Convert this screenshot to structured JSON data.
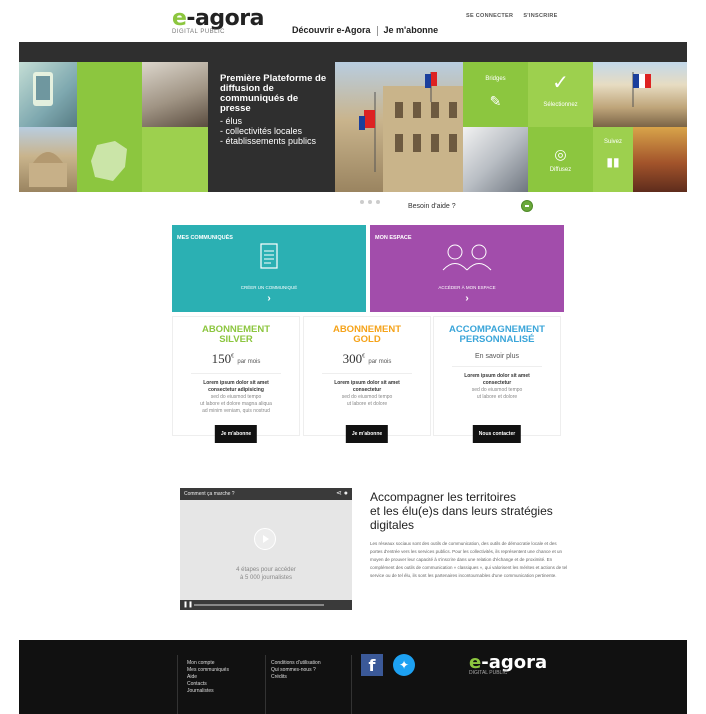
{
  "header": {
    "logo_mark_e": "e",
    "logo_mark_rest": "-agora",
    "logo_sub": "DIGITAL PUBLIC",
    "nav": [
      "Découvrir e-Agora",
      "Je m'abonne"
    ],
    "auth": {
      "login": "SE CONNECTER",
      "signup": "S'INSCRIRE"
    }
  },
  "hero": {
    "headline": "Première Plateforme de diffusion de communiqués de presse",
    "bullets": [
      "élus",
      "collectivités locales",
      "établissements publics"
    ],
    "tiles": {
      "bridges": "Bridges",
      "select": "Sélectionnez",
      "diffuse": "Diffusez",
      "follow": "Suivez"
    }
  },
  "slider": {
    "help": "Besoin d'aide ?"
  },
  "features": {
    "communiques": {
      "title": "MES COMMUNIQUÉS",
      "action": "CRÉER UN COMMUNIQUÉ",
      "color": "#2bb0b3"
    },
    "espace": {
      "title": "MON ESPACE",
      "action": "ACCÉDER À MON ESPACE",
      "color": "#a24dab"
    }
  },
  "pricing": [
    {
      "title1": "ABONNEMENT",
      "title2": "SILVER",
      "price": "150",
      "currency": "€",
      "per": "par mois",
      "desc_bold": [
        "Lorem ipsum dolor sit amet",
        "consectetur adipisicing"
      ],
      "desc": [
        "sed do eiusmod tempo",
        "ut labore et dolore magna aliqua",
        "ad minim veniam, quis nostrud"
      ],
      "button": "Je m'abonne",
      "color": "#8cc63f"
    },
    {
      "title1": "ABONNEMENT",
      "title2": "GOLD",
      "price": "300",
      "currency": "€",
      "per": "par mois",
      "desc_bold": [
        "Lorem ipsum dolor sit amet",
        "consectetur"
      ],
      "desc": [
        "sed do eiusmod tempo",
        "ut labore et dolore"
      ],
      "button": "Je m'abonne",
      "color": "#f5a31a"
    },
    {
      "title1": "ACCOMPAGNEMENT",
      "title2": "PERSONNALISÉ",
      "more": "En savoir plus",
      "desc_bold": [
        "Lorem ipsum dolor sit amet",
        "consectetur"
      ],
      "desc": [
        "sed do eiusmod tempo",
        "ut labore et dolore"
      ],
      "button": "Nous contacter",
      "color": "#3aa5d9"
    }
  ],
  "video": {
    "title": "Comment ça marche ?",
    "caption1": "4 étapes pour accéder",
    "caption2": "à 5 000 journalistes"
  },
  "promo": {
    "heading1": "Accompagner les territoires",
    "heading2": "et les élu(e)s dans leurs stratégies",
    "heading3": "digitales",
    "body": "Les réseaux sociaux sont des outils de communication, des outils de démocratie locale et des portes d'entrée vers les services publics. Pour les collectivités, ils représentent une chance et un moyen de prouver leur capacité à s'inscrire dans une relation d'échange et de proximité. En complément des outils de communication « classiques », qui valorisent les mérites et actions de tel service ou de tel élu, ils sont les partenaires incontournables d'une communication pertinente."
  },
  "footer": {
    "col1": [
      "Mon compte",
      "Mes communiqués",
      "Aide",
      "Contacts",
      "Journalistes"
    ],
    "col2": [
      "Conditions d'utilisation",
      "Qui sommes-nous ?",
      "Crédits"
    ],
    "logo_sub": "DIGITAL PUBLIC"
  },
  "colors": {
    "green": "#8cc63f",
    "dark": "#2f2f2f",
    "teal": "#2bb0b3",
    "purple": "#a24dab",
    "gold": "#f5a31a",
    "blue": "#3aa5d9"
  }
}
